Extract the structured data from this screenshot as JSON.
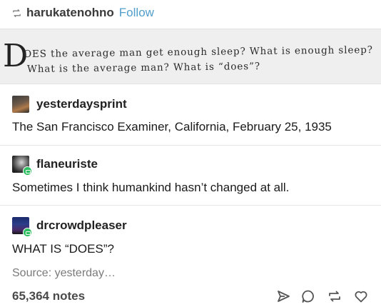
{
  "header": {
    "reblog_icon": "reblog-icon",
    "username": "harukatenohno",
    "follow_label": "Follow"
  },
  "clipping": {
    "drop_cap": "D",
    "line1": "OES the average man get enough sleep?  What is enough sleep?",
    "line2": "What is the average man?  What is “does”?"
  },
  "trail": [
    {
      "username": "yesterdaysprint",
      "text": "The San Francisco Examiner, California, February 25, 1935",
      "avatar": "avatar-yesterdaysprint"
    },
    {
      "username": "flaneuriste",
      "text": "Sometimes I think humankind hasn’t changed at all.",
      "avatar": "avatar-flaneuriste"
    },
    {
      "username": "drcrowdpleaser",
      "text": "WHAT IS “DOES”?",
      "avatar": "avatar-drcrowdpleaser"
    }
  ],
  "footer": {
    "source": "Source: yesterday…",
    "notes": "65,364 notes",
    "actions": [
      "share-icon",
      "comment-icon",
      "reblog-icon",
      "like-icon"
    ]
  },
  "colors": {
    "follow": "#529ecc",
    "badge": "#2dbe60"
  }
}
